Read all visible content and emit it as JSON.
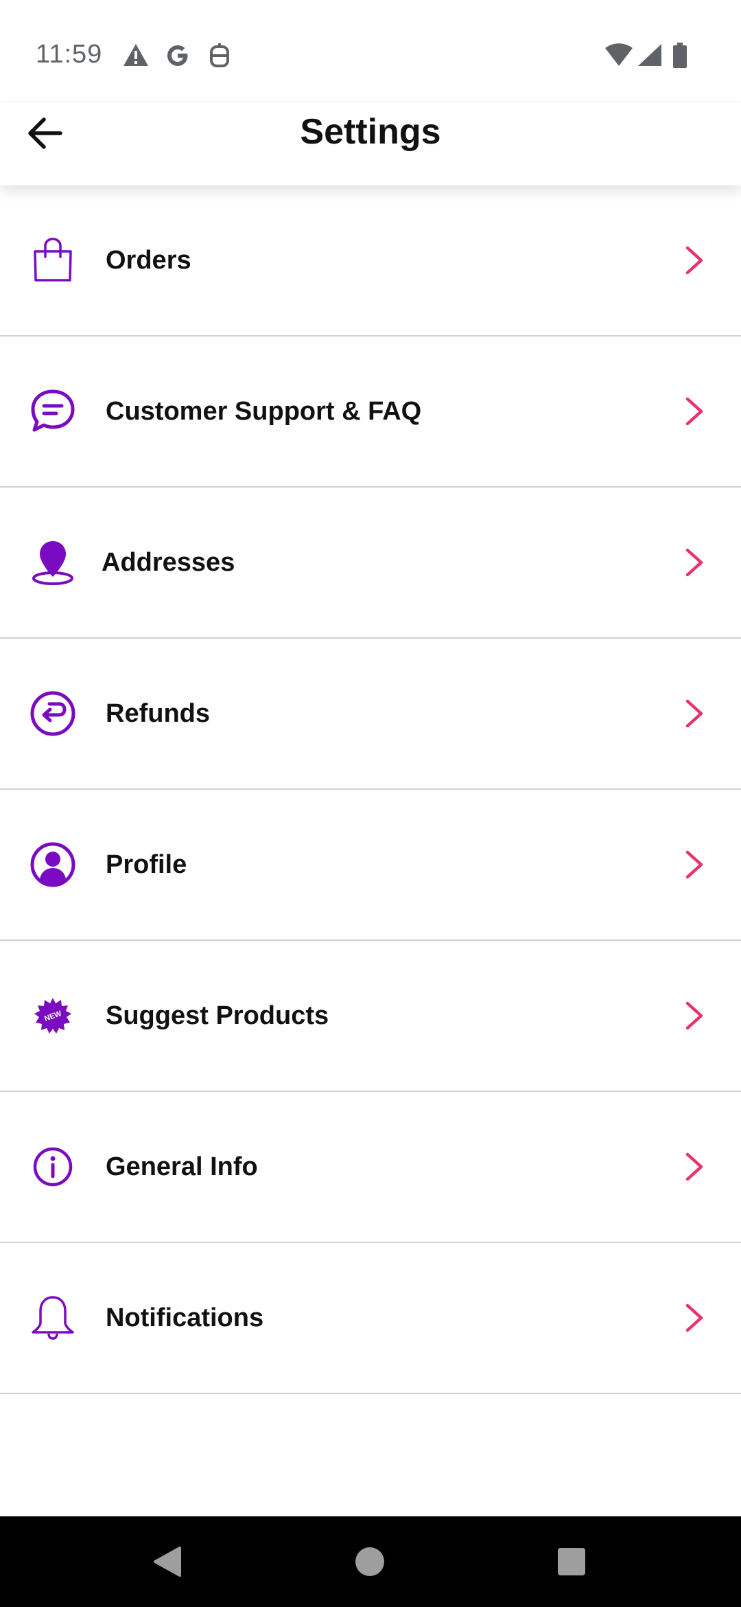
{
  "status_bar": {
    "time": "11:59",
    "icons": [
      "warning-icon",
      "google-icon",
      "robot-icon",
      "wifi-icon",
      "signal-icon",
      "battery-icon"
    ]
  },
  "header": {
    "title": "Settings",
    "back_icon": "arrow-left-icon"
  },
  "colors": {
    "icon_purple": "#7a0bc0",
    "chevron_pink": "#e8336b",
    "divider": "#d2d2d6"
  },
  "settings": {
    "items": [
      {
        "label": "Orders",
        "icon": "shopping-bag-icon"
      },
      {
        "label": "Customer Support & FAQ",
        "icon": "chat-bubble-icon"
      },
      {
        "label": "Addresses",
        "icon": "location-pin-icon"
      },
      {
        "label": "Refunds",
        "icon": "refund-icon"
      },
      {
        "label": "Profile",
        "icon": "profile-icon"
      },
      {
        "label": "Suggest Products",
        "icon": "new-badge-icon",
        "badge_text": "NEW"
      },
      {
        "label": "General Info",
        "icon": "info-icon"
      },
      {
        "label": "Notifications",
        "icon": "bell-icon"
      }
    ]
  },
  "nav_bar": {
    "buttons": [
      "back-triangle-icon",
      "home-circle-icon",
      "recents-square-icon"
    ]
  }
}
